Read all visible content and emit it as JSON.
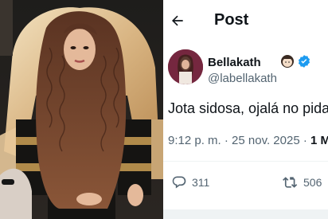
{
  "header": {
    "title": "Post",
    "back_icon": "arrow-left-icon"
  },
  "author": {
    "display_name": "Bellakath",
    "name_emoji": "woman-emoji",
    "verified_icon": "verified-badge-icon",
    "verified_color": "#1d9bf0",
    "handle": "@labellakath"
  },
  "post": {
    "text": "Jota sidosa, ojalá no pida",
    "timestamp": "9:12 p. m. · 25 nov. 2025 · ",
    "views_fragment": "1 M"
  },
  "actions": {
    "reply_icon": "reply-icon",
    "reply_count": "311",
    "repost_icon": "repost-icon",
    "repost_count": "506"
  },
  "colors": {
    "text_primary": "#0f1419",
    "text_secondary": "#536471",
    "accent": "#1d9bf0"
  }
}
